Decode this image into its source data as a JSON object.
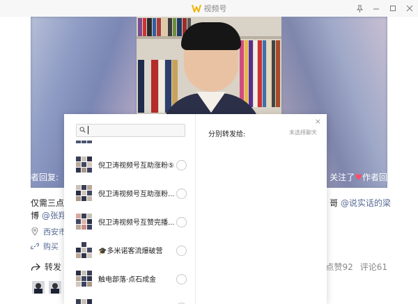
{
  "window": {
    "title": "视频号",
    "controls": [
      "pin-icon",
      "minimize-icon",
      "maximize-icon",
      "close-icon"
    ]
  },
  "video": {
    "caption_left": "者回复:",
    "caption_right_1": "关注了",
    "caption_right_2": "作者回"
  },
  "post": {
    "text_line1": "仅需三点,",
    "text_line2_prefix": "博 ",
    "mention_left": "@张翔",
    "text_right_1": "哥 ",
    "mention_right": "@说实话的梁",
    "location": "西安市",
    "shop": "购买",
    "forward_label": "转发",
    "likes_label": "点赞92",
    "comments_label": "评论61"
  },
  "modal": {
    "search": {
      "placeholder": ""
    },
    "right_title": "分别转发给:",
    "right_hint": "未选择聊天",
    "close": "×",
    "chats": [
      {
        "name": "倪卫涛视频号互助涨粉⑤"
      },
      {
        "name": "倪卫涛视频号互助涨粉..."
      },
      {
        "name": "倪卫涛视频号互赞完播..."
      },
      {
        "name": "🎓多米诺客流爆破营"
      },
      {
        "name": "触电部落·点石成金"
      }
    ]
  },
  "colors": {
    "link": "#576b95",
    "heart": "#ff4d6a"
  }
}
